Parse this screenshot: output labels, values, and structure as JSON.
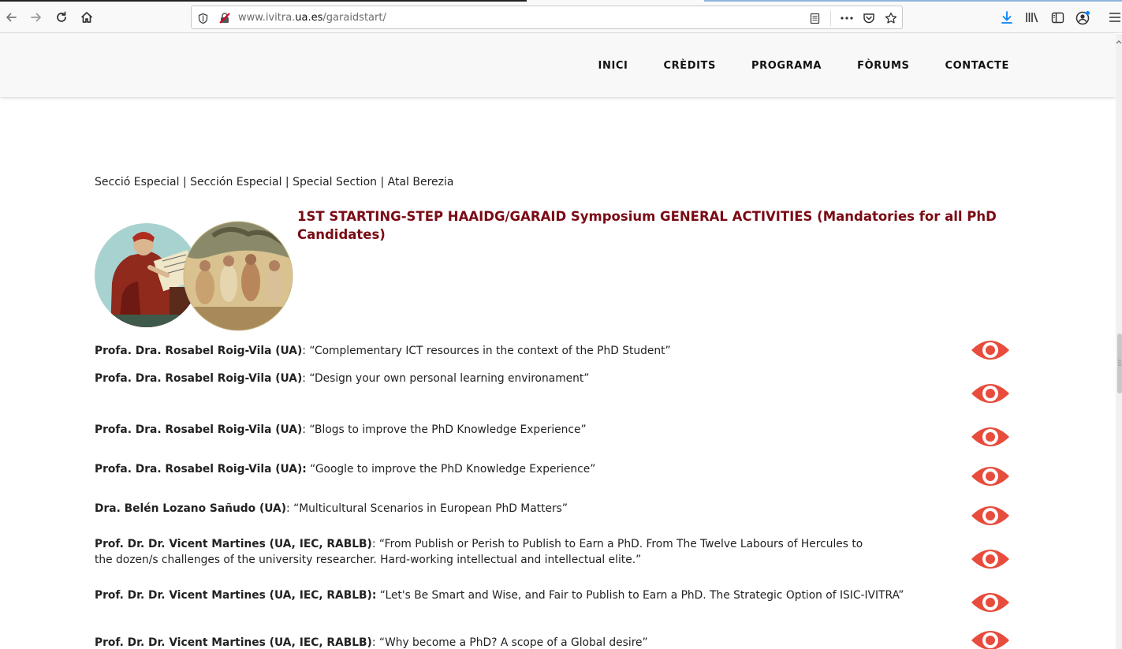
{
  "browser": {
    "url_prefix": "www.ivitra.",
    "url_host": "ua.es",
    "url_path": "/garaidstart/"
  },
  "nav": {
    "items": [
      "INICI",
      "CRÈDITS",
      "PROGRAMA",
      "FÒRUMS",
      "CONTACTE"
    ]
  },
  "breadcrumb": "Secció Especial | Sección Especial | Special Section | Atal Berezia",
  "title": "1ST STARTING-STEP HAAIDG/GARAID Symposium GENERAL ACTIVITIES (Mandatories for all PhD Candidates)",
  "accent_color": "#e74c3c",
  "activities": [
    {
      "speaker": "Profa. Dra. Rosabel Roig-Vila (UA)",
      "sep": ": ",
      "talk": "“Complementary ICT resources in the context of the PhD Student”"
    },
    {
      "speaker": "Profa. Dra. Rosabel Roig-Vila (UA)",
      "sep": ": ",
      "talk": "“Design your own personal learning environament”"
    },
    {
      "speaker": "Profa. Dra. Rosabel Roig-Vila (UA)",
      "sep": ": ",
      "talk": "“Blogs to improve the PhD Knowledge Experience”"
    },
    {
      "speaker": "Profa. Dra. Rosabel Roig-Vila (UA):",
      "sep": " ",
      "talk": "“Google to improve the PhD Knowledge Experience”"
    },
    {
      "speaker": "Dra. Belén Lozano Sañudo (UA)",
      "sep": ": ",
      "talk": "“Multicultural Scenarios in European PhD Matters”"
    },
    {
      "speaker": "Prof. Dr. Dr. Vicent Martines (UA, IEC, RABLB)",
      "sep": ": ",
      "talk": "“From Publish or Perish to Publish to Earn a PhD. From The Twelve Labours of Hercules to the dozen/s challenges of the university researcher. Hard-working intellectual and intellectual elite.”"
    },
    {
      "speaker": "Prof. Dr. Dr. Vicent Martines (UA, IEC, RABLB):",
      "sep": " ",
      "talk": "“Let's Be Smart and Wise, and Fair to Publish to Earn a PhD. The Strategic Option of ISIC-IVITRA”"
    },
    {
      "speaker": "Prof. Dr. Dr. Vicent Martines (UA, IEC, RABLB)",
      "sep": ": ",
      "talk": "“Why become a PhD? A scope of a Global desire”"
    }
  ]
}
